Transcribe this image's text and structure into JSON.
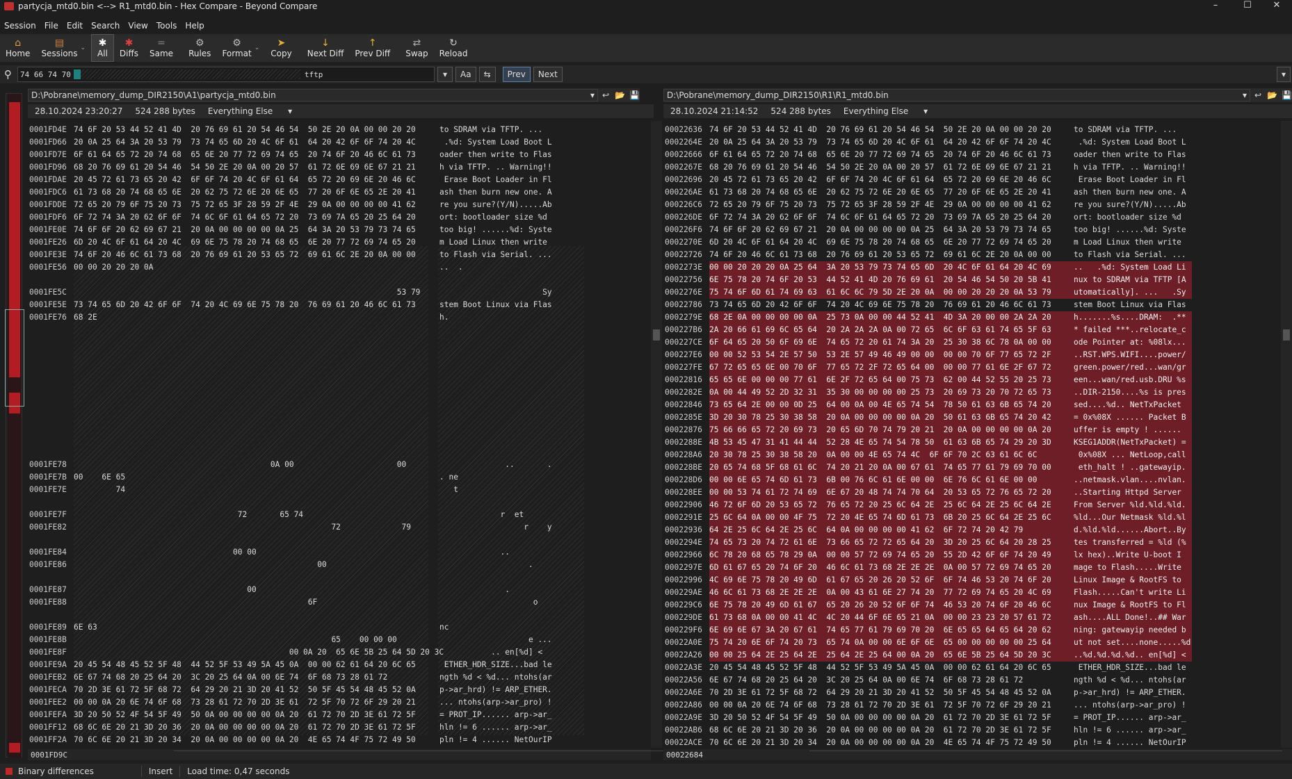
{
  "window": {
    "title": "partycja_mtd0.bin <--> R1_mtd0.bin - Hex Compare - Beyond Compare"
  },
  "menu": [
    "Session",
    "File",
    "Edit",
    "Search",
    "View",
    "Tools",
    "Help"
  ],
  "toolbar": [
    {
      "label": "Home",
      "icon": "home-icon"
    },
    {
      "label": "Sessions",
      "icon": "sessions-icon"
    },
    {
      "label": "All",
      "icon": "asterisk-icon"
    },
    {
      "label": "Diffs",
      "icon": "diffs-icon"
    },
    {
      "label": "Same",
      "icon": "same-icon"
    },
    {
      "label": "Rules",
      "icon": "rules-icon"
    },
    {
      "label": "Format",
      "icon": "format-icon"
    },
    {
      "label": "Copy",
      "icon": "copy-arrow-icon"
    },
    {
      "label": "Next Diff",
      "icon": "down-arrow-icon"
    },
    {
      "label": "Prev Diff",
      "icon": "up-arrow-icon"
    },
    {
      "label": "Swap",
      "icon": "swap-icon"
    },
    {
      "label": "Reload",
      "icon": "reload-icon"
    }
  ],
  "search": {
    "hex_value": "74 66 74 70",
    "text_value": "tftp",
    "case_label": "Aa",
    "prev": "Prev",
    "next": "Next"
  },
  "left": {
    "path": "D:\\Pobrane\\memory_dump_DIR2150\\A1\\partycja_mtd0.bin",
    "date": "28.10.2024 23:20:27",
    "size": "524 288 bytes",
    "filter": "Everything Else",
    "footer_addr": "0001FD9C",
    "rows": [
      {
        "a": "0001FD4E",
        "h": "74 6F 20 53 44 52 41 4D  20 76 69 61 20 54 46 54  50 2E 20 0A 00 00 20 20",
        "t": "to SDRAM via TFTP. ..."
      },
      {
        "a": "0001FD66",
        "h": "20 0A 25 64 3A 20 53 79  73 74 65 6D 20 4C 6F 61  64 20 42 6F 6F 74 20 4C",
        "t": " .%d: System Load Boot L"
      },
      {
        "a": "0001FD7E",
        "h": "6F 61 64 65 72 20 74 68  65 6E 20 77 72 69 74 65  20 74 6F 20 46 6C 61 73",
        "t": "oader then write to Flas"
      },
      {
        "a": "0001FD96",
        "h": "68 20 76 69 61 20 54 46  54 50 2E 20 0A 00 20 57  61 72 6E 69 6E 67 21 21",
        "t": "h via TFTP. .. Warning!!"
      },
      {
        "a": "0001FDAE",
        "h": "20 45 72 61 73 65 20 42  6F 6F 74 20 4C 6F 61 64  65 72 20 69 6E 20 46 6C",
        "t": " Erase Boot Loader in Fl"
      },
      {
        "a": "0001FDC6",
        "h": "61 73 68 20 74 68 65 6E  20 62 75 72 6E 20 6E 65  77 20 6F 6E 65 2E 20 41",
        "t": "ash then burn new one. A"
      },
      {
        "a": "0001FDDE",
        "h": "72 65 20 79 6F 75 20 73  75 72 65 3F 28 59 2F 4E  29 0A 00 00 00 00 41 62",
        "t": "re you sure?(Y/N).....Ab"
      },
      {
        "a": "0001FDF6",
        "h": "6F 72 74 3A 20 62 6F 6F  74 6C 6F 61 64 65 72 20  73 69 7A 65 20 25 64 20",
        "t": "ort: bootloader size %d "
      },
      {
        "a": "0001FE0E",
        "h": "74 6F 6F 20 62 69 67 21  20 0A 00 00 00 00 0A 25  64 3A 20 53 79 73 74 65",
        "t": "too big! ......%d: Syste"
      },
      {
        "a": "0001FE26",
        "h": "6D 20 4C 6F 61 64 20 4C  69 6E 75 78 20 74 68 65  6E 20 77 72 69 74 65 20",
        "t": "m Load Linux then write "
      },
      {
        "a": "0001FE3E",
        "h": "74 6F 20 46 6C 61 73 68  20 76 69 61 20 53 65 72  69 61 6C 2E 20 0A 00 00",
        "t": "to Flash via Serial. ..."
      },
      {
        "a": "0001FE56",
        "h": "00 00 20 20 20 0A",
        "t": "..  ."
      },
      {
        "a": "",
        "h": "",
        "t": ""
      },
      {
        "a": "0001FE5C",
        "h": "                                                                     53 79",
        "t": "                      Sy"
      },
      {
        "a": "0001FE5E",
        "h": "73 74 65 6D 20 42 6F 6F  74 20 4C 69 6E 75 78 20  76 69 61 20 46 6C 61 73",
        "t": "stem Boot Linux via Flas"
      },
      {
        "a": "0001FE76",
        "h": "68 2E",
        "t": "h."
      }
    ],
    "rows2": [
      {
        "a": "0001FE78",
        "h": "                                          0A 00                      00",
        "t": "              ..       ."
      },
      {
        "a": "0001FE7B",
        "h": "00    6E 65",
        "t": ". ne"
      },
      {
        "a": "0001FE7E",
        "h": "         74",
        "t": "   t"
      },
      {
        "a": "",
        "h": "",
        "t": ""
      },
      {
        "a": "0001FE7F",
        "h": "                                   72       65 74",
        "t": "             r  et"
      },
      {
        "a": "0001FE82",
        "h": "                                                       72             79",
        "t": "                  r    y"
      },
      {
        "a": "",
        "h": "",
        "t": ""
      },
      {
        "a": "0001FE84",
        "h": "                                  00 00",
        "t": "             .."
      },
      {
        "a": "0001FE86",
        "h": "                                                    00",
        "t": "                   ."
      },
      {
        "a": "",
        "h": "",
        "t": ""
      },
      {
        "a": "0001FE87",
        "h": "                                     00",
        "t": "              ."
      },
      {
        "a": "0001FE88",
        "h": "                                                  6F",
        "t": "                    o"
      },
      {
        "a": "",
        "h": "",
        "t": ""
      },
      {
        "a": "0001FE89",
        "h": "6E 63",
        "t": "nc"
      },
      {
        "a": "0001FE8B",
        "h": "                                                       65    00 00 00",
        "t": "                   e ..."
      },
      {
        "a": "0001FE8F",
        "h": "                                              00 0A 20  65 6E 5B 25 64 5D 20 3C",
        "t": "           .. en[%d] <"
      },
      {
        "a": "0001FE9A",
        "h": "20 45 54 48 45 52 5F 48  44 52 5F 53 49 5A 45 0A  00 00 62 61 64 20 6C 65",
        "t": " ETHER_HDR_SIZE...bad le"
      },
      {
        "a": "0001FEB2",
        "h": "6E 67 74 68 20 25 64 20  3C 20 25 64 0A 00 6E 74  6F 68 73 28 61 72",
        "t": "ngth %d < %d... ntohs(ar"
      },
      {
        "a": "0001FECA",
        "h": "70 2D 3E 61 72 5F 68 72  64 29 20 21 3D 20 41 52  50 5F 45 54 48 45 52 0A",
        "t": "p->ar_hrd) != ARP_ETHER."
      },
      {
        "a": "0001FEE2",
        "h": "00 00 0A 20 6E 74 6F 68  73 28 61 72 70 2D 3E 61  72 5F 70 72 6F 29 20 21",
        "t": "... ntohs(arp->ar_pro) !"
      },
      {
        "a": "0001FEFA",
        "h": "3D 20 50 52 4F 54 5F 49  50 0A 00 00 00 00 0A 20  61 72 70 2D 3E 61 72 5F",
        "t": "= PROT_IP...... arp->ar_"
      },
      {
        "a": "0001FF12",
        "h": "68 6C 6E 20 21 3D 20 36  20 0A 00 00 00 00 0A 20  61 72 70 2D 3E 61 72 5F",
        "t": "hln != 6 ...... arp->ar_"
      },
      {
        "a": "0001FF2A",
        "h": "70 6C 6E 20 21 3D 20 34  20 0A 00 00 00 00 0A 20  4E 65 74 4F 75 72 49 50",
        "t": "pln != 4 ...... NetOurIP"
      }
    ]
  },
  "right": {
    "path": "D:\\Pobrane\\memory_dump_DIR2150\\R1\\R1_mtd0.bin",
    "date": "28.10.2024 21:14:52",
    "size": "524 288 bytes",
    "filter": "Everything Else",
    "footer_addr": "00022684",
    "rows": [
      {
        "a": "00022636",
        "h": "74 6F 20 53 44 52 41 4D  20 76 69 61 20 54 46 54  50 2E 20 0A 00 00 20 20",
        "t": "to SDRAM via TFTP. ...",
        "d": 0
      },
      {
        "a": "0002264E",
        "h": "20 0A 25 64 3A 20 53 79  73 74 65 6D 20 4C 6F 61  64 20 42 6F 6F 74 20 4C",
        "t": " .%d: System Load Boot L",
        "d": 0
      },
      {
        "a": "00022666",
        "h": "6F 61 64 65 72 20 74 68  65 6E 20 77 72 69 74 65  20 74 6F 20 46 6C 61 73",
        "t": "oader then write to Flas",
        "d": 0
      },
      {
        "a": "0002267E",
        "h": "68 20 76 69 61 20 54 46  54 50 2E 20 0A 00 20 57  61 72 6E 69 6E 67 21 21",
        "t": "h via TFTP. .. Warning!!",
        "d": 0
      },
      {
        "a": "00022696",
        "h": "20 45 72 61 73 65 20 42  6F 6F 74 20 4C 6F 61 64  65 72 20 69 6E 20 46 6C",
        "t": " Erase Boot Loader in Fl",
        "d": 0
      },
      {
        "a": "000226AE",
        "h": "61 73 68 20 74 68 65 6E  20 62 75 72 6E 20 6E 65  77 20 6F 6E 65 2E 20 41",
        "t": "ash then burn new one. A",
        "d": 0
      },
      {
        "a": "000226C6",
        "h": "72 65 20 79 6F 75 20 73  75 72 65 3F 28 59 2F 4E  29 0A 00 00 00 00 41 62",
        "t": "re you sure?(Y/N).....Ab",
        "d": 0
      },
      {
        "a": "000226DE",
        "h": "6F 72 74 3A 20 62 6F 6F  74 6C 6F 61 64 65 72 20  73 69 7A 65 20 25 64 20",
        "t": "ort: bootloader size %d ",
        "d": 0
      },
      {
        "a": "000226F6",
        "h": "74 6F 6F 20 62 69 67 21  20 0A 00 00 00 00 0A 25  64 3A 20 53 79 73 74 65",
        "t": "too big! ......%d: Syste",
        "d": 0
      },
      {
        "a": "0002270E",
        "h": "6D 20 4C 6F 61 64 20 4C  69 6E 75 78 20 74 68 65  6E 20 77 72 69 74 65 20",
        "t": "m Load Linux then write ",
        "d": 0
      },
      {
        "a": "00022726",
        "h": "74 6F 20 46 6C 61 73 68  20 76 69 61 20 53 65 72  69 61 6C 2E 20 0A 00 00",
        "t": "to Flash via Serial. ...",
        "d": 0
      },
      {
        "a": "0002273E",
        "h": "00 00 20 20 20 0A 25 64  3A 20 53 79 73 74 65 6D  20 4C 6F 61 64 20 4C 69",
        "t": "..   .%d: System Load Li",
        "d": 1
      },
      {
        "a": "00022756",
        "h": "6E 75 78 20 74 6F 20 53  44 52 41 4D 20 76 69 61  20 54 46 54 50 20 5B 41",
        "t": "nux to SDRAM via TFTP [A",
        "d": 1
      },
      {
        "a": "0002276E",
        "h": "75 74 6F 6D 61 74 69 63  61 6C 6C 79 5D 2E 20 0A  00 00 20 20 20 0A 53 79",
        "t": "utomatically]. ...   .Sy",
        "d": 1
      },
      {
        "a": "00022786",
        "h": "73 74 65 6D 20 42 6F 6F  74 20 4C 69 6E 75 78 20  76 69 61 20 46 6C 61 73",
        "t": "stem Boot Linux via Flas",
        "d": 0
      },
      {
        "a": "0002279E",
        "h": "68 2E 0A 00 00 00 00 0A  25 73 0A 00 00 44 52 41  4D 3A 20 00 00 2A 2A 20",
        "t": "h.......%s....DRAM:  .**",
        "d": 1
      },
      {
        "a": "000227B6",
        "h": "2A 20 66 61 69 6C 65 64  20 2A 2A 2A 0A 00 72 65  6C 6F 63 61 74 65 5F 63",
        "t": "* failed ***..relocate_c",
        "d": 1
      },
      {
        "a": "000227CE",
        "h": "6F 64 65 20 50 6F 69 6E  74 65 72 20 61 74 3A 20  25 30 38 6C 78 0A 00 00",
        "t": "ode Pointer at: %08lx...",
        "d": 1
      },
      {
        "a": "000227E6",
        "h": "00 00 52 53 54 2E 57 50  53 2E 57 49 46 49 00 00  00 00 70 6F 77 65 72 2F",
        "t": "..RST.WPS.WIFI....power/",
        "d": 1
      },
      {
        "a": "000227FE",
        "h": "67 72 65 65 6E 00 70 6F  77 65 72 2F 72 65 64 00  00 00 77 61 6E 2F 67 72",
        "t": "green.power/red...wan/gr",
        "d": 1
      },
      {
        "a": "00022816",
        "h": "65 65 6E 00 00 00 77 61  6E 2F 72 65 64 00 75 73  62 00 44 52 55 20 25 73",
        "t": "een...wan/red.usb.DRU %s",
        "d": 1
      },
      {
        "a": "0002282E",
        "h": "0A 00 44 49 52 2D 32 31  35 30 00 00 00 00 25 73  20 69 73 20 70 72 65 73",
        "t": "..DIR-2150....%s is pres",
        "d": 1
      },
      {
        "a": "00022846",
        "h": "73 65 64 2E 00 00 0D 25  64 00 0A 00 4E 65 74 54  78 50 61 63 6B 65 74 20",
        "t": "sed....%d.. NetTxPacket ",
        "d": 1
      },
      {
        "a": "0002285E",
        "h": "3D 20 30 78 25 30 38 58  20 0A 00 00 00 00 0A 20  50 61 63 6B 65 74 20 42",
        "t": "= 0x%08X ...... Packet B",
        "d": 1
      },
      {
        "a": "00022876",
        "h": "75 66 66 65 72 20 69 73  20 65 6D 70 74 79 20 21  20 0A 00 00 00 00 0A 20",
        "t": "uffer is empty ! ......",
        "d": 1
      },
      {
        "a": "0002288E",
        "h": "4B 53 45 47 31 41 44 44  52 28 4E 65 74 54 78 50  61 63 6B 65 74 29 20 3D",
        "t": "KSEG1ADDR(NetTxPacket) =",
        "d": 1
      },
      {
        "a": "000228A6",
        "h": "20 30 78 25 30 38 58 20  0A 00 00 4E 65 74 4C  6F 6F 70 2C 63 61 6C 6C",
        "t": " 0x%08X ... NetLoop,call",
        "d": 1
      },
      {
        "a": "000228BE",
        "h": "20 65 74 68 5F 68 61 6C  74 20 21 20 0A 00 67 61  74 65 77 61 79 69 70 00",
        "t": " eth_halt ! ..gatewayip.",
        "d": 1
      },
      {
        "a": "000228D6",
        "h": "00 00 6E 65 74 6D 61 73  6B 00 76 6C 61 6E 00 00  6E 76 6C 61 6E 00 00",
        "t": "..netmask.vlan....nvlan.",
        "d": 1
      },
      {
        "a": "000228EE",
        "h": "00 00 53 74 61 72 74 69  6E 67 20 48 74 74 70 64  20 53 65 72 76 65 72 20",
        "t": "..Starting Httpd Server ",
        "d": 1
      },
      {
        "a": "00022906",
        "h": "46 72 6F 6D 20 53 65 72  76 65 72 20 25 6C 64 2E  25 6C 64 2E 25 6C 64 2E",
        "t": "From Server %ld.%ld.%ld.",
        "d": 1
      },
      {
        "a": "0002291E",
        "h": "25 6C 64 0A 00 00 4F 75  72 20 4E 65 74 6D 61 73  6B 20 25 6C 64 2E 25 6C",
        "t": "%ld...Our Netmask %ld.%l",
        "d": 1
      },
      {
        "a": "00022936",
        "h": "64 2E 25 6C 64 2E 25 6C  64 0A 00 00 00 00 41 62  6F 72 74 20 42 79",
        "t": "d.%ld.%ld......Abort..By",
        "d": 1
      },
      {
        "a": "0002294E",
        "h": "74 65 73 20 74 72 61 6E  73 66 65 72 72 65 64 20  3D 20 25 6C 64 20 28 25",
        "t": "tes transferred = %ld (%",
        "d": 1
      },
      {
        "a": "00022966",
        "h": "6C 78 20 68 65 78 29 0A  00 00 57 72 69 74 65 20  55 2D 42 6F 6F 74 20 49",
        "t": "lx hex)..Write U-boot I",
        "d": 1
      },
      {
        "a": "0002297E",
        "h": "6D 61 67 65 20 74 6F 20  46 6C 61 73 68 2E 2E 2E  0A 00 57 72 69 74 65 20",
        "t": "mage to Flash.....Write ",
        "d": 1
      },
      {
        "a": "00022996",
        "h": "4C 69 6E 75 78 20 49 6D  61 67 65 20 26 20 52 6F  6F 74 46 53 20 74 6F 20",
        "t": "Linux Image & RootFS to ",
        "d": 1
      },
      {
        "a": "000229AE",
        "h": "46 6C 61 73 68 2E 2E 2E  0A 00 43 61 6E 27 74 20  77 72 69 74 65 20 4C 69",
        "t": "Flash.....Can't write Li",
        "d": 1
      },
      {
        "a": "000229C6",
        "h": "6E 75 78 20 49 6D 61 67  65 20 26 20 52 6F 6F 74  46 53 20 74 6F 20 46 6C",
        "t": "nux Image & RootFS to Fl",
        "d": 1
      },
      {
        "a": "000229DE",
        "h": "61 73 68 0A 00 00 41 4C  4C 20 44 6F 6E 65 21 0A  00 00 23 23 20 57 61 72",
        "t": "ash....ALL Done!..## War",
        "d": 1
      },
      {
        "a": "000229F6",
        "h": "6E 69 6E 67 3A 20 67 61  74 65 77 61 79 69 70 20  6E 65 65 64 65 64 20 62",
        "t": "ning: gatewayip needed b",
        "d": 1
      },
      {
        "a": "00022A0E",
        "h": "75 74 20 6E 6F 74 20 73  65 74 0A 00 00 6E 6F 6E  65 00 00 00 00 00 25 64",
        "t": "ut not set....none.....%d",
        "d": 1
      },
      {
        "a": "00022A26",
        "h": "00 00 25 64 2E 25 64 2E  25 64 2E 25 64 00 0A 20  65 6E 5B 25 64 5D 20 3C",
        "t": "..%d.%d.%d.%d.. en[%d] <",
        "d": 1
      },
      {
        "a": "00022A3E",
        "h": "20 45 54 48 45 52 5F 48  44 52 5F 53 49 5A 45 0A  00 00 62 61 64 20 6C 65",
        "t": " ETHER_HDR_SIZE...bad le",
        "d": 0
      },
      {
        "a": "00022A56",
        "h": "6E 67 74 68 20 25 64 20  3C 20 25 64 0A 00 6E 74  6F 68 73 28 61 72",
        "t": "ngth %d < %d... ntohs(ar",
        "d": 0
      },
      {
        "a": "00022A6E",
        "h": "70 2D 3E 61 72 5F 68 72  64 29 20 21 3D 20 41 52  50 5F 45 54 48 45 52 0A",
        "t": "p->ar_hrd) != ARP_ETHER.",
        "d": 0
      },
      {
        "a": "00022A86",
        "h": "00 00 0A 20 6E 74 6F 68  73 28 61 72 70 2D 3E 61  72 5F 70 72 6F 29 20 21",
        "t": "... ntohs(arp->ar_pro) !",
        "d": 0
      },
      {
        "a": "00022A9E",
        "h": "3D 20 50 52 4F 54 5F 49  50 0A 00 00 00 00 0A 20  61 72 70 2D 3E 61 72 5F",
        "t": "= PROT_IP...... arp->ar_",
        "d": 0
      },
      {
        "a": "00022AB6",
        "h": "68 6C 6E 20 21 3D 20 36  20 0A 00 00 00 00 0A 20  61 72 70 2D 3E 61 72 5F",
        "t": "hln != 6 ...... arp->ar_",
        "d": 0
      },
      {
        "a": "00022ACE",
        "h": "70 6C 6E 20 21 3D 20 34  20 0A 00 00 00 00 0A 20  4E 65 74 4F 75 72 49 50",
        "t": "pln != 4 ...... NetOurIP",
        "d": 0
      }
    ]
  },
  "status": {
    "text": "Binary differences",
    "mode": "Insert",
    "load_time": "Load time: 0,47 seconds"
  }
}
